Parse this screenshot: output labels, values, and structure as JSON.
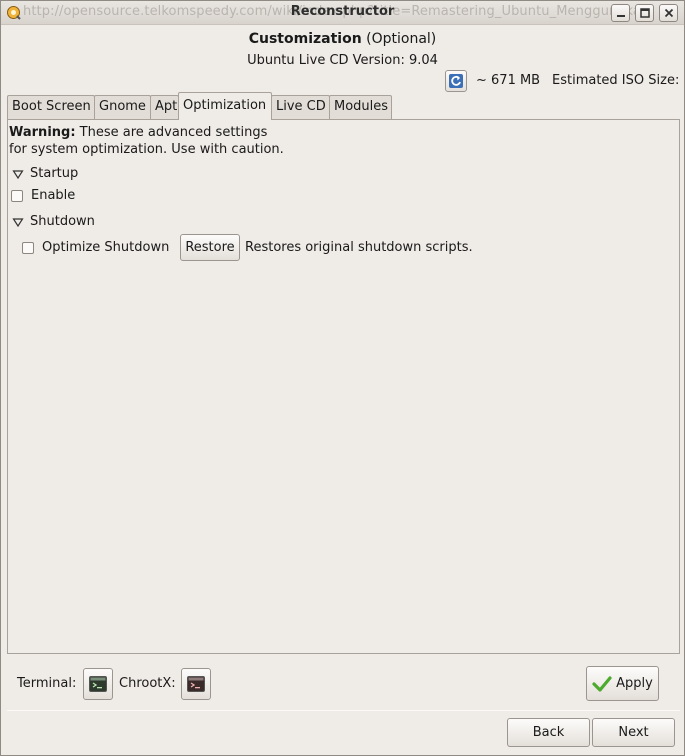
{
  "window": {
    "background_url_text": "http://opensource.telkomspeedy.com/wiki/index.php?title=Remastering_Ubuntu_Menggunakan",
    "title": "Reconstructor"
  },
  "header": {
    "title_bold": "Customization",
    "title_rest": " (Optional)",
    "version": "Ubuntu Live CD Version: 9.04",
    "size": "~ 671 MB",
    "iso_label": "Estimated ISO Size:"
  },
  "tabs": [
    {
      "label": "Boot Screen"
    },
    {
      "label": "Gnome"
    },
    {
      "label": "Apt"
    },
    {
      "label": "Optimization",
      "active": true
    },
    {
      "label": "Live CD"
    },
    {
      "label": "Modules"
    }
  ],
  "optimization": {
    "warning_bold": "Warning:",
    "warning_line1": " These are advanced settings",
    "warning_line2": "for system optimization. Use with caution.",
    "startup": {
      "label": "Startup",
      "enable_label": "Enable",
      "enable_checked": false
    },
    "shutdown": {
      "label": "Shutdown",
      "optimize_label": "Optimize Shutdown",
      "optimize_checked": false,
      "restore_label": "Restore",
      "restore_desc": "Restores original shutdown scripts."
    }
  },
  "toolbar": {
    "terminal_label": "Terminal:",
    "chrootx_label": "ChrootX:",
    "apply_label": "Apply",
    "back_label": "Back",
    "next_label": "Next"
  },
  "icons": {
    "app": "reconstructor-icon",
    "refresh": "refresh-icon",
    "terminal": "terminal-icon",
    "chrootx": "chroot-terminal-icon",
    "apply": "check-icon"
  },
  "colors": {
    "window_bg": "#efebe7",
    "apply_check": "#4caa2c",
    "refresh_blue": "#3b6fb6"
  }
}
